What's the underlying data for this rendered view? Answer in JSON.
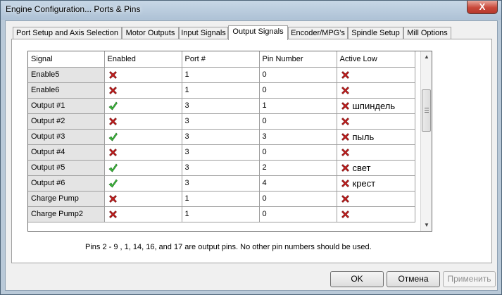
{
  "window": {
    "title": "Engine Configuration... Ports & Pins",
    "close_glyph": "X"
  },
  "tabs": [
    {
      "label": "Port Setup and Axis Selection",
      "active": false
    },
    {
      "label": "Motor Outputs",
      "active": false
    },
    {
      "label": "Input Signals",
      "active": false
    },
    {
      "label": "Output Signals",
      "active": true
    },
    {
      "label": "Encoder/MPG's",
      "active": false
    },
    {
      "label": "Spindle Setup",
      "active": false
    },
    {
      "label": "Mill Options",
      "active": false
    }
  ],
  "grid": {
    "columns": [
      "Signal",
      "Enabled",
      "Port #",
      "Pin Number",
      "Active Low"
    ],
    "rows": [
      {
        "signal": "Enable5",
        "enabled": "no",
        "port": "1",
        "pin": "0",
        "active_low": "no",
        "note": ""
      },
      {
        "signal": "Enable6",
        "enabled": "no",
        "port": "1",
        "pin": "0",
        "active_low": "no",
        "note": ""
      },
      {
        "signal": "Output #1",
        "enabled": "yes",
        "port": "3",
        "pin": "1",
        "active_low": "no",
        "note": "шпиндель"
      },
      {
        "signal": "Output #2",
        "enabled": "no",
        "port": "3",
        "pin": "0",
        "active_low": "no",
        "note": ""
      },
      {
        "signal": "Output #3",
        "enabled": "yes",
        "port": "3",
        "pin": "3",
        "active_low": "no",
        "note": "пыль"
      },
      {
        "signal": "Output #4",
        "enabled": "no",
        "port": "3",
        "pin": "0",
        "active_low": "no",
        "note": ""
      },
      {
        "signal": "Output #5",
        "enabled": "yes",
        "port": "3",
        "pin": "2",
        "active_low": "no",
        "note": "свет"
      },
      {
        "signal": "Output #6",
        "enabled": "yes",
        "port": "3",
        "pin": "4",
        "active_low": "no",
        "note": "крест"
      },
      {
        "signal": "Charge Pump",
        "enabled": "no",
        "port": "1",
        "pin": "0",
        "active_low": "no",
        "note": ""
      },
      {
        "signal": "Charge Pump2",
        "enabled": "no",
        "port": "1",
        "pin": "0",
        "active_low": "no",
        "note": ""
      }
    ],
    "icons": {
      "yes": "green-check-icon",
      "no": "red-x-icon"
    },
    "colors": {
      "check": "#3dbb3d",
      "x": "#c81e1e"
    }
  },
  "footnote": "Pins 2 - 9 , 1, 14, 16, and 17 are output pins.  No  other pin numbers should be used.",
  "buttons": {
    "ok": "OK",
    "cancel": "Отмена",
    "apply": "Применить"
  }
}
